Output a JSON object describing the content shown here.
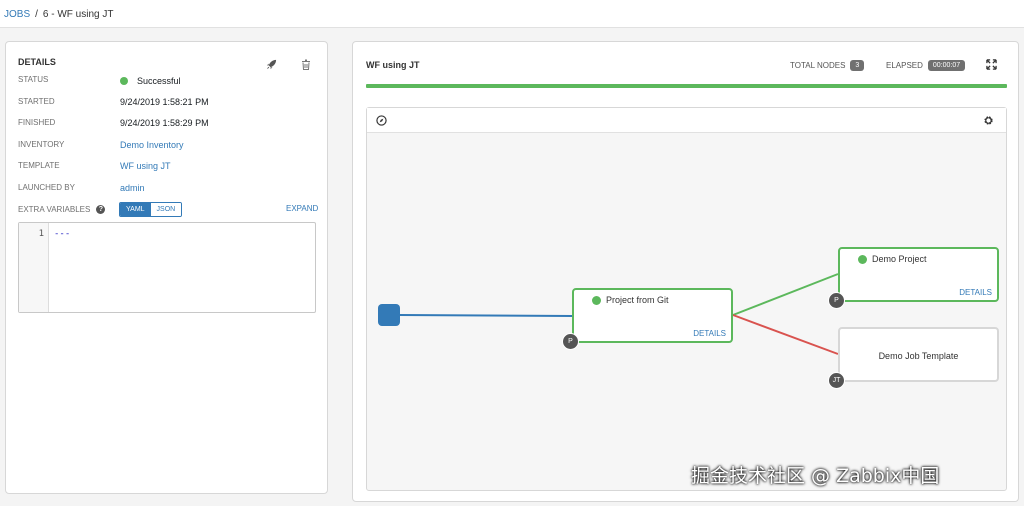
{
  "breadcrumb": {
    "jobs": "JOBS",
    "separator": "/",
    "current": "6 - WF using JT"
  },
  "details": {
    "title": "DETAILS",
    "rows": [
      {
        "label": "STATUS",
        "value": "Successful",
        "status_color": "#5cb85c"
      },
      {
        "label": "STARTED",
        "value": "9/24/2019 1:58:21 PM"
      },
      {
        "label": "FINISHED",
        "value": "9/24/2019 1:58:29 PM"
      },
      {
        "label": "INVENTORY",
        "value": "Demo Inventory"
      },
      {
        "label": "TEMPLATE",
        "value": "WF using JT"
      },
      {
        "label": "LAUNCHED BY",
        "value": "admin"
      }
    ],
    "extra_variables_label": "EXTRA VARIABLES",
    "toggle": {
      "yaml": "YAML",
      "json": "JSON",
      "selected": "YAML"
    },
    "expand_label": "EXPAND",
    "editor": {
      "line_number": "1",
      "content": "---"
    }
  },
  "workflow": {
    "title": "WF using JT",
    "total_nodes_label": "TOTAL NODES",
    "total_nodes": "3",
    "elapsed_label": "ELAPSED",
    "elapsed": "00:00:07",
    "progress": 1.0,
    "nodes": {
      "project_git": {
        "name": "Project from Git",
        "details": "DETAILS",
        "badge": "P"
      },
      "demo_project": {
        "name": "Demo Project",
        "details": "DETAILS",
        "badge": "P"
      },
      "demo_jt": {
        "name": "Demo Job Template",
        "badge": "JT"
      }
    }
  },
  "watermark": "掘金技术社区 @ Zabbix中国",
  "colors": {
    "accent": "#337ab7",
    "success": "#5cb85c",
    "failure": "#d9534f"
  }
}
